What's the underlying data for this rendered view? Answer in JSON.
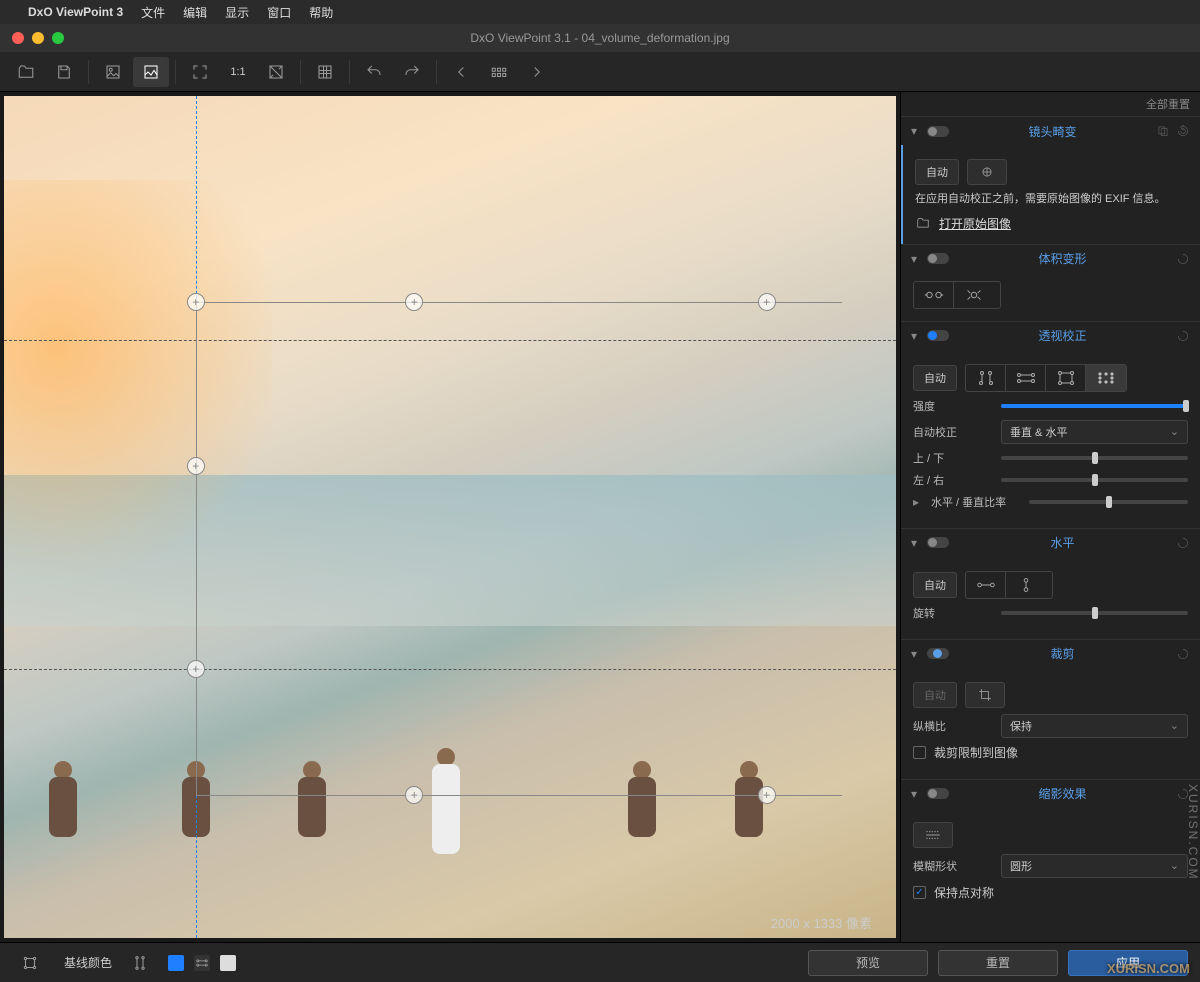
{
  "menubar": {
    "app": "DxO ViewPoint 3",
    "items": [
      "文件",
      "编辑",
      "显示",
      "窗口",
      "帮助"
    ]
  },
  "window": {
    "title": "DxO ViewPoint 3.1 - 04_volume_deformation.jpg"
  },
  "toolbar": {
    "zoom_label": "1:1"
  },
  "canvas": {
    "dimensions": "2000 x 1333 像素"
  },
  "bottombar": {
    "baseline": "基线颜色",
    "preview": "预览",
    "reset": "重置",
    "apply": "应用"
  },
  "side": {
    "reset_all": "全部重置",
    "distortion": {
      "title": "镜头畸变",
      "auto": "自动",
      "info": "在应用自动校正之前，需要原始图像的 EXIF 信息。",
      "open": "打开原始图像"
    },
    "volume": {
      "title": "体积变形"
    },
    "perspective": {
      "title": "透视校正",
      "auto": "自动",
      "intensity": "强度",
      "autocorrect": "自动校正",
      "autocorrect_val": "垂直 & 水平",
      "updown": "上 / 下",
      "leftright": "左 / 右",
      "ratio": "水平 / 垂直比率"
    },
    "horizon": {
      "title": "水平",
      "auto": "自动",
      "rotate": "旋转"
    },
    "crop": {
      "title": "裁剪",
      "auto": "自动",
      "aspect": "纵横比",
      "aspect_val": "保持",
      "limit": "裁剪限制到图像"
    },
    "miniature": {
      "title": "缩影效果",
      "blur": "模糊形状",
      "blur_val": "圆形",
      "symmetric": "保持点对称"
    }
  },
  "watermark": "XURISN.COM",
  "watermark2": "XURISN.COM"
}
